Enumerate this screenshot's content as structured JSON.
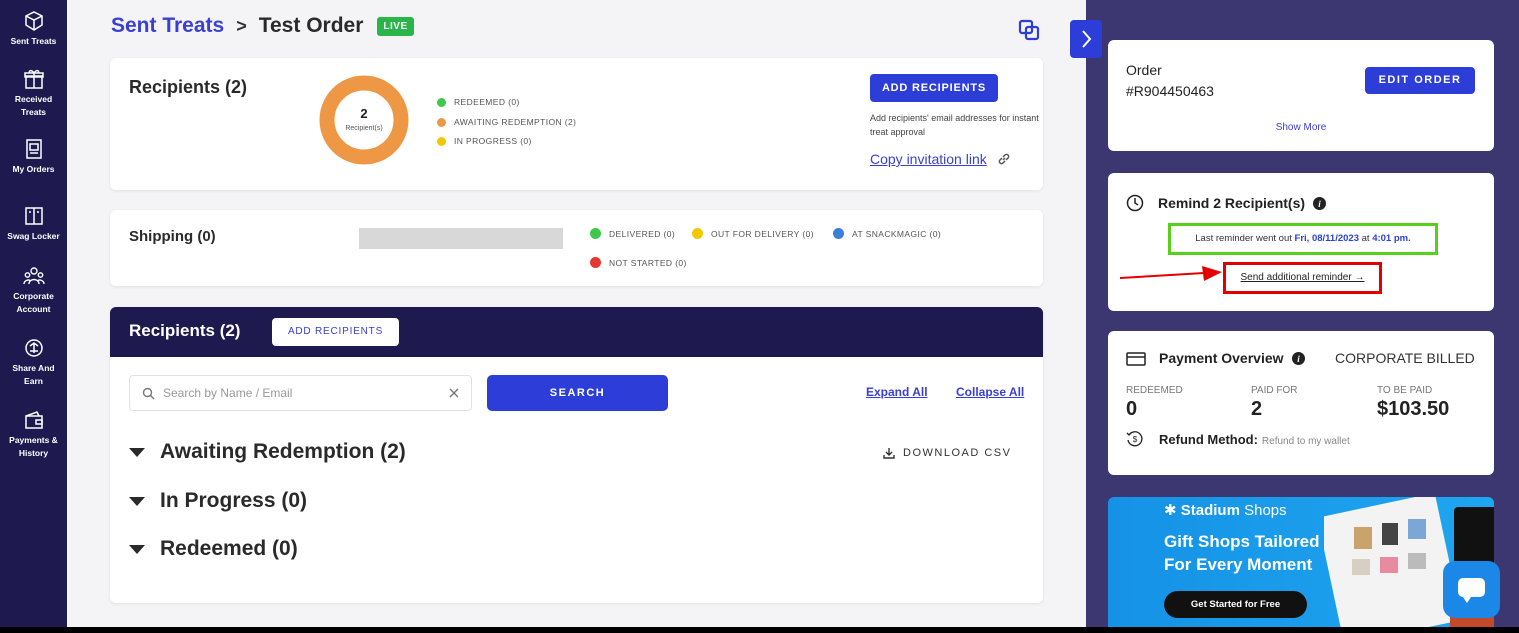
{
  "sidebar": {
    "items": [
      {
        "label_lines": [
          "Sent Treats"
        ],
        "icon": "gift-box-icon"
      },
      {
        "label_lines": [
          "Received",
          "Treats"
        ],
        "icon": "present-icon"
      },
      {
        "label_lines": [
          "My Orders"
        ],
        "icon": "orders-icon"
      },
      {
        "label_lines": [
          "Swag Locker"
        ],
        "icon": "locker-icon"
      },
      {
        "label_lines": [
          "Corporate",
          "Account"
        ],
        "icon": "team-icon"
      },
      {
        "label_lines": [
          "Share And",
          "Earn"
        ],
        "icon": "share-icon"
      },
      {
        "label_lines": [
          "Payments &",
          "History"
        ],
        "icon": "wallet-icon"
      }
    ]
  },
  "header": {
    "breadcrumb_link": "Sent Treats",
    "separator": ">",
    "current": "Test Order",
    "status_badge": "LIVE"
  },
  "recipients_summary": {
    "title": "Recipients (2)",
    "donut_count": "2",
    "donut_caption": "Recipient(s)",
    "legend": [
      {
        "label": "REDEEMED (0)",
        "color": "#3fc94a"
      },
      {
        "label": "AWAITING REDEMPTION (2)",
        "color": "#ee9845"
      },
      {
        "label": "IN PROGRESS (0)",
        "color": "#f2c800"
      }
    ],
    "add_button": "ADD RECIPIENTS",
    "add_note": "Add recipients' email addresses for instant treat approval",
    "copy_link": "Copy invitation link"
  },
  "shipping": {
    "title": "Shipping (0)",
    "legend": [
      {
        "label": "DELIVERED (0)",
        "color": "#3fc94a"
      },
      {
        "label": "OUT FOR DELIVERY (0)",
        "color": "#f2c800"
      },
      {
        "label": "AT SNACKMAGIC (0)",
        "color": "#3a7fd9"
      },
      {
        "label": "NOT STARTED (0)",
        "color": "#e8372e"
      }
    ]
  },
  "recipients_list": {
    "title": "Recipients (2)",
    "add_button": "ADD RECIPIENTS",
    "search_placeholder": "Search by Name / Email",
    "search_button": "SEARCH",
    "expand_all": "Expand All",
    "collapse_all": "Collapse All",
    "download_csv": "DOWNLOAD CSV",
    "groups": [
      "Awaiting Redemption (2)",
      "In Progress (0)",
      "Redeemed (0)"
    ]
  },
  "order_card": {
    "label": "Order",
    "number": "#R904450463",
    "edit_button": "EDIT ORDER",
    "show_more": "Show More"
  },
  "remind_card": {
    "title": "Remind 2 Recipient(s)",
    "last_prefix": "Last reminder went out",
    "last_date": "Fri, 08/11/2023",
    "at": "at",
    "last_time": "4:01 pm.",
    "send_link": "Send additional reminder →",
    "highlight_green": "#55d11a",
    "highlight_red": "#e40000"
  },
  "payment_card": {
    "title": "Payment Overview",
    "billing": "CORPORATE BILLED",
    "stats": [
      {
        "label": "REDEEMED",
        "value": "0"
      },
      {
        "label": "PAID FOR",
        "value": "2"
      },
      {
        "label": "TO BE PAID",
        "value": "$103.50"
      }
    ],
    "refund_label": "Refund Method:",
    "refund_value": "Refund to my wallet"
  },
  "promo": {
    "brand_bold": "Stadium",
    "brand_light": " Shops",
    "headline_1": "Gift Shops Tailored",
    "headline_2": "For Every Moment",
    "cta": "Get Started for Free"
  },
  "colors": {
    "sidebar_bg": "#1e1a4f",
    "accent": "#2d3ed8",
    "right_panel_bg": "#3c3770"
  }
}
